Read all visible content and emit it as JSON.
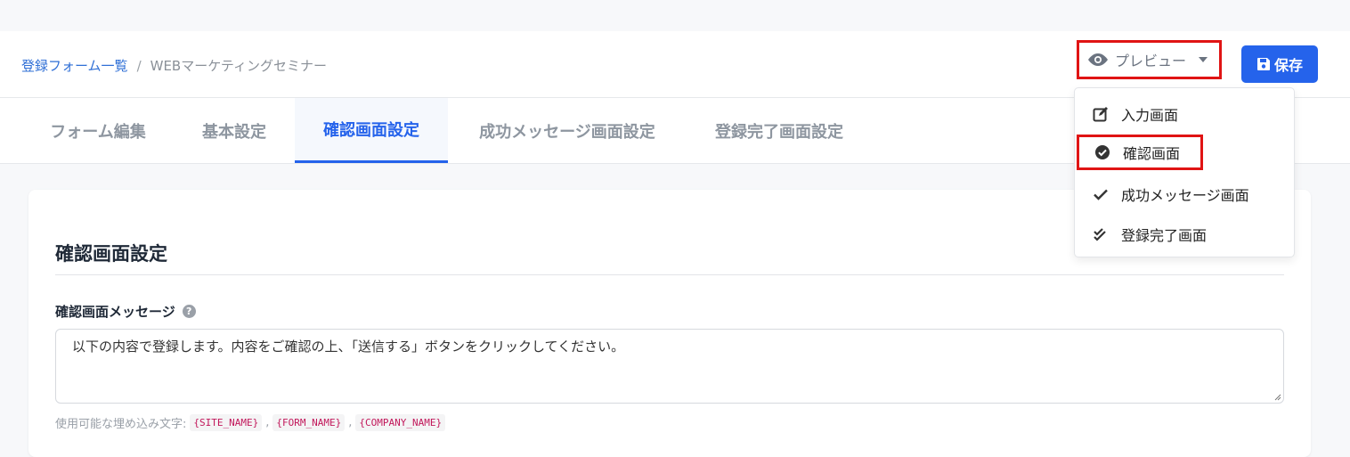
{
  "breadcrumb": {
    "parent": "登録フォーム一覧",
    "separator": "/",
    "current": "WEBマーケティングセミナー"
  },
  "header": {
    "preview_label": "プレビュー",
    "save_label": "保存"
  },
  "tabs": [
    {
      "label": "フォーム編集"
    },
    {
      "label": "基本設定"
    },
    {
      "label": "確認画面設定",
      "active": true
    },
    {
      "label": "成功メッセージ画面設定"
    },
    {
      "label": "登録完了画面設定"
    }
  ],
  "dropdown": {
    "items": [
      {
        "label": "入力画面",
        "icon": "edit-icon"
      },
      {
        "label": "確認画面",
        "icon": "check-circle-icon"
      },
      {
        "label": "成功メッセージ画面",
        "icon": "check-icon"
      },
      {
        "label": "登録完了画面",
        "icon": "double-check-icon"
      }
    ]
  },
  "card": {
    "title": "確認画面設定",
    "field_label": "確認画面メッセージ",
    "help": "?",
    "message": "以下の内容で登録します。内容をご確認の上、「送信する」ボタンをクリックしてください。",
    "helper_label": "使用可能な埋め込み文字:",
    "tokens": [
      "{SITE_NAME}",
      "{FORM_NAME}",
      "{COMPANY_NAME}"
    ],
    "token_sep": ","
  },
  "colors": {
    "accent": "#2563eb",
    "highlight": "#e01414",
    "link": "#2f6fd6"
  }
}
